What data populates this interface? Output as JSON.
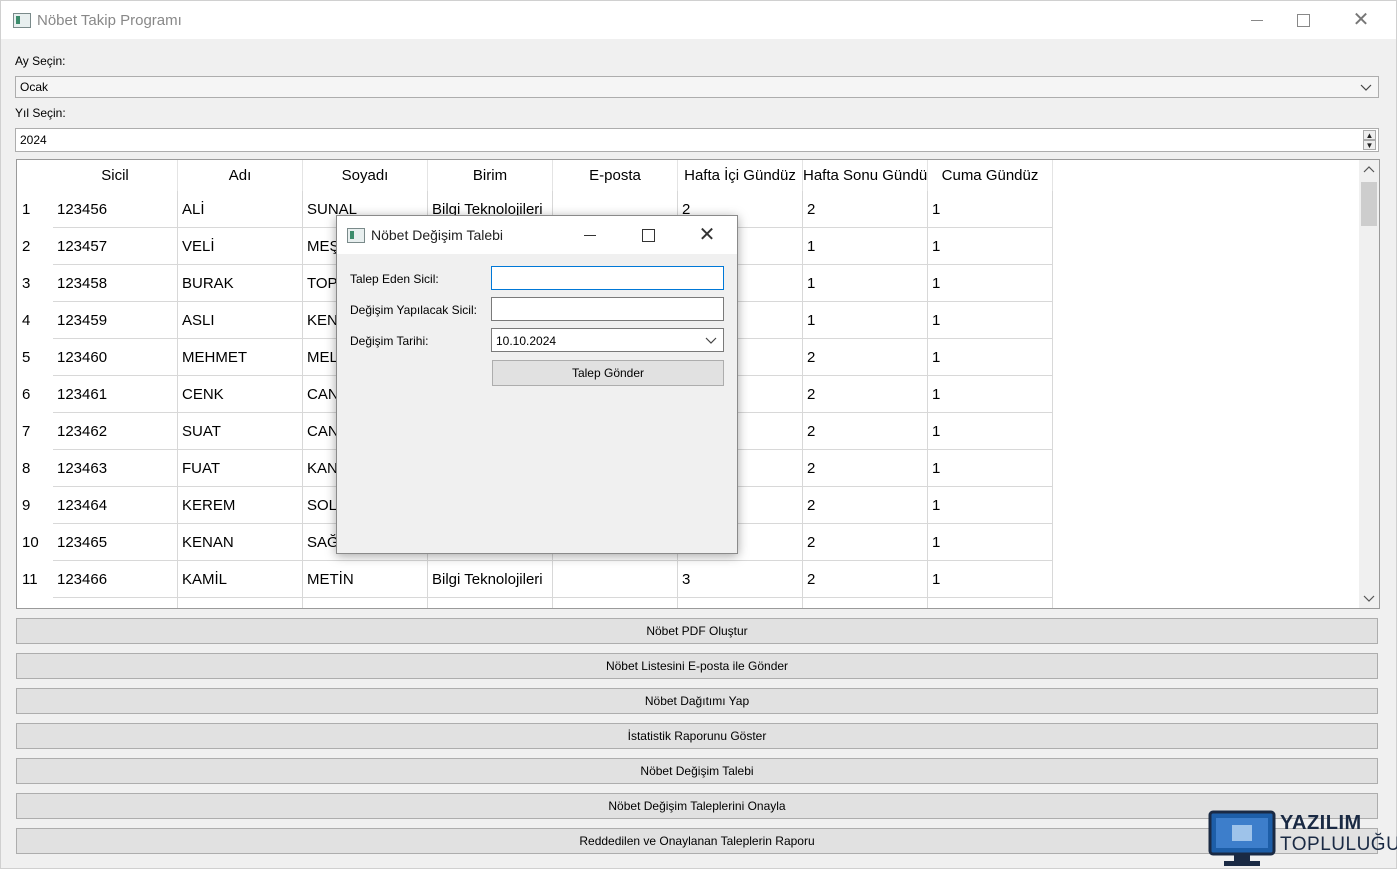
{
  "window": {
    "title": "Nöbet Takip Programı"
  },
  "month": {
    "label": "Ay Seçin:",
    "value": "Ocak"
  },
  "year": {
    "label": "Yıl Seçin:",
    "value": "2024"
  },
  "table": {
    "columns": [
      "Sicil",
      "Adı",
      "Soyadı",
      "Birim",
      "E-posta",
      "Hafta İçi Gündüz",
      "Hafta Sonu Gündüz",
      "Cuma Gündüz"
    ],
    "rows": [
      {
        "num": "1",
        "cells": [
          "123456",
          "ALİ",
          "SUNAL",
          "Bilgi Teknolojileri",
          "",
          "2",
          "2",
          "1"
        ]
      },
      {
        "num": "2",
        "cells": [
          "123457",
          "VELİ",
          "MEŞ",
          "",
          "",
          "",
          "1",
          "1"
        ]
      },
      {
        "num": "3",
        "cells": [
          "123458",
          "BURAK",
          "TOPA",
          "",
          "",
          "",
          "1",
          "1"
        ]
      },
      {
        "num": "4",
        "cells": [
          "123459",
          "ASLI",
          "KENA",
          "",
          "",
          "",
          "1",
          "1"
        ]
      },
      {
        "num": "5",
        "cells": [
          "123460",
          "MEHMET",
          "MELT",
          "",
          "",
          "",
          "2",
          "1"
        ]
      },
      {
        "num": "6",
        "cells": [
          "123461",
          "CENK",
          "CAN",
          "",
          "",
          "",
          "2",
          "1"
        ]
      },
      {
        "num": "7",
        "cells": [
          "123462",
          "SUAT",
          "CAN",
          "",
          "",
          "",
          "2",
          "1"
        ]
      },
      {
        "num": "8",
        "cells": [
          "123463",
          "FUAT",
          "KAN",
          "",
          "",
          "",
          "2",
          "1"
        ]
      },
      {
        "num": "9",
        "cells": [
          "123464",
          "KEREM",
          "SOL",
          "",
          "",
          "",
          "2",
          "1"
        ]
      },
      {
        "num": "10",
        "cells": [
          "123465",
          "KENAN",
          "SAĞ",
          "",
          "",
          "",
          "2",
          "1"
        ]
      },
      {
        "num": "11",
        "cells": [
          "123466",
          "KAMİL",
          "METİN",
          "Bilgi Teknolojileri",
          "",
          "3",
          "2",
          "1"
        ]
      }
    ]
  },
  "buttons": [
    "Nöbet PDF Oluştur",
    "Nöbet Listesini E-posta ile Gönder",
    "Nöbet Dağıtımı Yap",
    "İstatistik Raporunu Göster",
    "Nöbet Değişim Talebi",
    "Nöbet Değişim Taleplerini Onayla",
    "Reddedilen ve Onaylanan Taleplerin Raporu"
  ],
  "dialog": {
    "title": "Nöbet Değişim Talebi",
    "requester_label": "Talep Eden Sicil:",
    "requester_value": "",
    "target_label": "Değişim Yapılacak Sicil:",
    "target_value": "",
    "date_label": "Değişim Tarihi:",
    "date_value": "10.10.2024",
    "submit_label": "Talep Gönder"
  },
  "watermark": {
    "line1": "YAZILIM",
    "line2": "TOPLULUĞU"
  }
}
